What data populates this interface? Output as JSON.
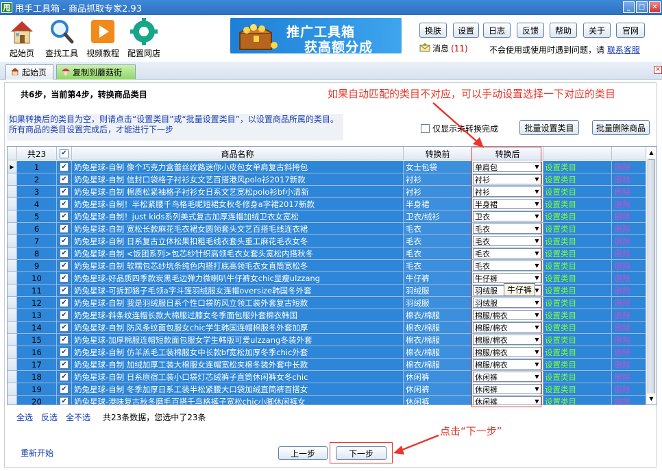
{
  "window": {
    "title": "甩手工具箱 - 商品抓取专家2.93",
    "logo": "甩"
  },
  "toolbar": {
    "tools": [
      {
        "label": "起始页",
        "icon": "house-icon"
      },
      {
        "label": "查找工具",
        "icon": "magnifier-icon"
      },
      {
        "label": "视频教程",
        "icon": "play-icon"
      },
      {
        "label": "配置网店",
        "icon": "gear-icon"
      }
    ],
    "banner": {
      "line1": "推广工具箱",
      "line2": "获高额分成"
    },
    "buttons": [
      "换肤",
      "设置",
      "日志",
      "反馈",
      "帮助",
      "关于",
      "官网"
    ],
    "messages": {
      "label": "消息",
      "count": "(11)"
    },
    "notice": {
      "text": "不会使用或使用时遇到问题，请",
      "link": "联系客服"
    }
  },
  "tabs": [
    {
      "label": "起始页",
      "icon": "house-icon"
    },
    {
      "label": "复制到蘑菇街",
      "icon": "mushroom-icon",
      "active": true
    }
  ],
  "content": {
    "step": "共6步，当前第4步，转换商品类目",
    "annotation_top": "如果自动匹配的类目不对应，可以手动设置选择一下对应的类目",
    "hint_line1": "如果转换后的类目为空，则请点击“设置类目”或“批量设置类目”，以设置商品所属的类目。",
    "hint_line2": "所有商品的类目设置完成后，才能进行下一步",
    "only_show_label": "仅显示未转换完成",
    "batch_set_label": "批量设置类目",
    "batch_delete_label": "批量删除商品",
    "tooltip": "牛仔裤",
    "annotation_bottom": "点击“下一步”"
  },
  "grid": {
    "headers": {
      "count": "共23",
      "name": "商品名称",
      "before": "转换前",
      "after": "转换后"
    },
    "set_label": "设置类目",
    "del_label": "删除",
    "rows": [
      {
        "n": "1",
        "name": "奶兔星球-自制 像个巧克力盒蕾丝纹路迷你小皮包女单肩复古斜挎包",
        "before": "女士包袋",
        "after": "单肩包"
      },
      {
        "n": "2",
        "name": "奶兔星球-自制 信封口袋格子衬衫女文艺百搭港风polo衫2017新款",
        "before": "衬衫",
        "after": "衬衫"
      },
      {
        "n": "3",
        "name": "奶兔星球-自制 棉质松紧袖格子衬衫女日系文艺宽松polo衫bf小清新",
        "before": "衬衫",
        "after": "衬衫"
      },
      {
        "n": "4",
        "name": "奶兔星球-自制！半松紧腰千鸟格毛呢短裙女秋冬修身a字裙2017新款",
        "before": "半身裙",
        "after": "半身裙"
      },
      {
        "n": "5",
        "name": "奶兔星球-自制！just kids系列美式复古加厚连帽加绒卫衣女宽松",
        "before": "卫衣/绒衫",
        "after": "卫衣"
      },
      {
        "n": "6",
        "name": "奶兔星球-自制 宽松长款麻花毛衣裙女圆领套头文艺百搭毛线连衣裙",
        "before": "毛衣",
        "after": "毛衣"
      },
      {
        "n": "7",
        "name": "奶兔星球-自制 日系复古立体松果扣粗毛线衣套头重工麻花毛衣女冬",
        "before": "毛衣",
        "after": "毛衣"
      },
      {
        "n": "8",
        "name": "奶兔星球-自制 <饭团系列>包芯纱针织高领毛衣女套头宽松内搭秋冬",
        "before": "毛衣",
        "after": "毛衣"
      },
      {
        "n": "9",
        "name": "奶兔星球-自制 软糯包芯纱坑条纯色内搭打底高领毛衣女直筒宽松冬",
        "before": "毛衣",
        "after": "毛衣"
      },
      {
        "n": "10",
        "name": "奶兔星球-好品质四季款炭黑毛边弹力微喇叭牛仔裤女chic显瘦ulzzang",
        "before": "牛仔裤",
        "after": "牛仔裤"
      },
      {
        "n": "11",
        "name": "奶兔星球-可拆卸貉子毛领a字斗篷羽绒服女连帽oversize韩国冬外套",
        "before": "羽绒服",
        "after": "羽绒服"
      },
      {
        "n": "12",
        "name": "奶兔星球-自制 我是羽绒服日系个性口袋防风立领工装外套复古短款",
        "before": "羽绒服",
        "after": "羽绒服"
      },
      {
        "n": "13",
        "name": "奶兔星球-斜条纹连帽长款大棉服过膝女冬季面包服外套棉衣韩国",
        "before": "棉衣/棉服",
        "after": "棉服/棉衣"
      },
      {
        "n": "14",
        "name": "奶兔星球-自制 防风条纹面包服女chic学生韩国连帽棉服冬外套加厚",
        "before": "棉衣/棉服",
        "after": "棉服/棉衣"
      },
      {
        "n": "15",
        "name": "奶兔星球-加厚棉服连帽短款面包服女学生韩版可爱ulzzang冬装外套",
        "before": "棉衣/棉服",
        "after": "棉服/棉衣"
      },
      {
        "n": "16",
        "name": "奶兔星球-自制 仿羊羔毛工装棉服女中长款bf宽松加厚冬季chic外套",
        "before": "棉衣/棉服",
        "after": "棉服/棉衣"
      },
      {
        "n": "17",
        "name": "奶兔星球-自制 加绒加厚工装大棉服女连帽宽松夹棉冬装外套中长款",
        "before": "棉衣/棉服",
        "after": "棉服/棉衣"
      },
      {
        "n": "18",
        "name": "奶兔星球-自制 日系原宿工装小口袋灯芯绒裤子直筒休闲裤女冬chic",
        "before": "休闲裤",
        "after": "休闲裤"
      },
      {
        "n": "19",
        "name": "奶兔星球-自制 冬季加厚日系工装半松紧腰大口袋加绒直筒裤百搭女",
        "before": "休闲裤",
        "after": "休闲裤"
      },
      {
        "n": "20",
        "name": "奶兔星球-港味复古秋冬磨毛百搭千鸟格裤子宽松chic小脚休闲裤女",
        "before": "休闲裤",
        "after": "休闲裤"
      }
    ]
  },
  "footer": {
    "select_all": "全选",
    "invert": "反选",
    "select_none": "全不选",
    "summary": "共23条数据，您选中了23条",
    "restart": "重新开始",
    "prev": "上一步",
    "next": "下一步"
  },
  "colors": {
    "annotation": "#e8382a",
    "selected_row": "#2e86d8",
    "link_green": "#7fff3a",
    "link_purple": "#c050d0"
  }
}
